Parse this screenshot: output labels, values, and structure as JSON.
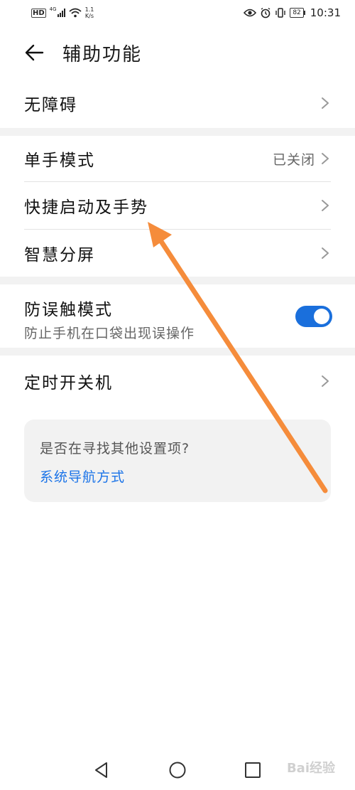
{
  "status_bar": {
    "hd": "HD",
    "net_type": "4G",
    "speed_value": "1.1",
    "speed_unit": "K/s",
    "battery": "82",
    "time": "10:31",
    "icons": [
      "eye-icon",
      "alarm-icon",
      "vibrate-icon",
      "battery-icon",
      "signal-icon",
      "wifi-icon"
    ]
  },
  "header": {
    "title": "辅助功能",
    "back_icon": "back-arrow-icon"
  },
  "rows": [
    {
      "label": "无障碍",
      "value": ""
    },
    {
      "label": "单手模式",
      "value": "已关闭"
    },
    {
      "label": "快捷启动及手势",
      "value": ""
    },
    {
      "label": "智慧分屏",
      "value": ""
    },
    {
      "label": "防误触模式",
      "subtitle": "防止手机在口袋出现误操作",
      "toggle_on": true
    },
    {
      "label": "定时开关机",
      "value": ""
    }
  ],
  "card": {
    "question": "是否在寻找其他设置项?",
    "link": "系统导航方式"
  },
  "navbar": {
    "icons": [
      "nav-back-icon",
      "nav-home-icon",
      "nav-recents-icon"
    ]
  },
  "watermark": "Bai经验",
  "colors": {
    "accent_blue": "#1a73e8",
    "toggle_blue": "#1a6fdc",
    "annotation_orange": "#f58c3b",
    "band_gray": "#f2f2f2"
  }
}
